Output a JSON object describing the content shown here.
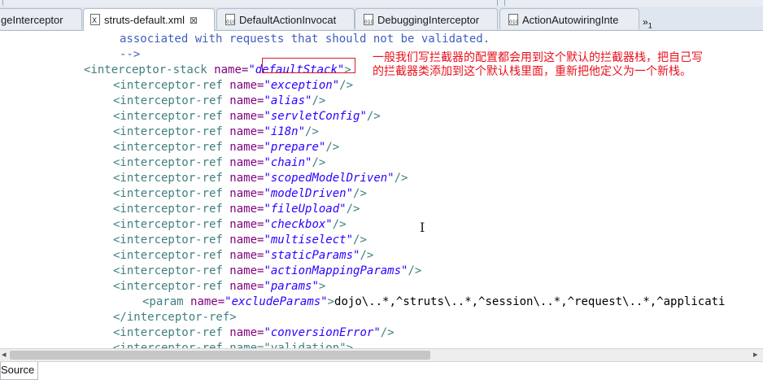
{
  "tabs": [
    {
      "label": "geInterceptor"
    },
    {
      "label": "struts-default.xml",
      "active": true,
      "close": "⊠"
    },
    {
      "label": "DefaultActionInvocat"
    },
    {
      "label": "DebuggingInterceptor"
    },
    {
      "label": "ActionAutowiringInte"
    }
  ],
  "overflow": {
    "glyph": "»",
    "count": "1"
  },
  "code": {
    "l1": "associated with requests that should not be validated.",
    "l2": "-->",
    "stack_open": "<interceptor-stack ",
    "name_attr": "name=",
    "stack_name": "\"defaultStack\"",
    "stack_close": ">",
    "ref_open": "<interceptor-ref ",
    "ref_close": "/>",
    "refs": [
      "\"exception\"",
      "\"alias\"",
      "\"servletConfig\"",
      "\"i18n\"",
      "\"prepare\"",
      "\"chain\"",
      "\"scopedModelDriven\"",
      "\"modelDriven\"",
      "\"fileUpload\"",
      "\"checkbox\"",
      "\"multiselect\"",
      "\"staticParams\"",
      "\"actionMappingParams\""
    ],
    "params_name": "\"params\"",
    "param_open": "<param ",
    "param_name": "\"excludeParams\"",
    "param_text": "dojo\\..*,^struts\\..*,^session\\..*,^request\\..*,^applicati",
    "ref_end": "</interceptor-ref>",
    "conversion": "\"conversionError\"",
    "partial": "<interceptor-ref name=\"validation\">"
  },
  "annotation": {
    "line1": "一般我们写拦截器的配置都会用到这个默认的拦截器栈，把自己写",
    "line2": "的拦截器类添加到这个默认栈里面，重新把他定义为一个新栈。"
  },
  "bottom": {
    "source_tab": "Source"
  },
  "colors": {
    "tag": "#3f7f7f",
    "attribute": "#7f007f",
    "value": "#2a00ff",
    "comment": "#3f5fbf",
    "annotation": "#e8101b"
  }
}
